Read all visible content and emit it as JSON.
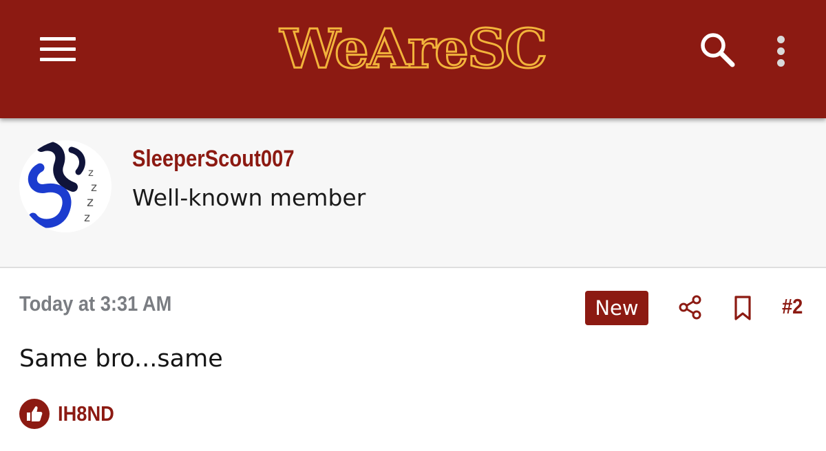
{
  "header": {
    "logo_text": "WeAreSC",
    "brand_color": "#8c1a12",
    "logo_outline_color": "#f2b33b",
    "menu_icon": "hamburger-menu-icon",
    "search_icon": "search-icon",
    "more_icon": "more-vertical-icon"
  },
  "author": {
    "username": "SleeperScout007",
    "user_title": "Well-known member"
  },
  "post": {
    "timestamp": "Today at 3:31 AM",
    "badge": "New",
    "share_icon": "share-icon",
    "bookmark_icon": "bookmark-icon",
    "post_number": "#2",
    "body": "Same bro...same",
    "reactions": {
      "icon": "thumbs-up-icon",
      "users": "IH8ND"
    }
  }
}
